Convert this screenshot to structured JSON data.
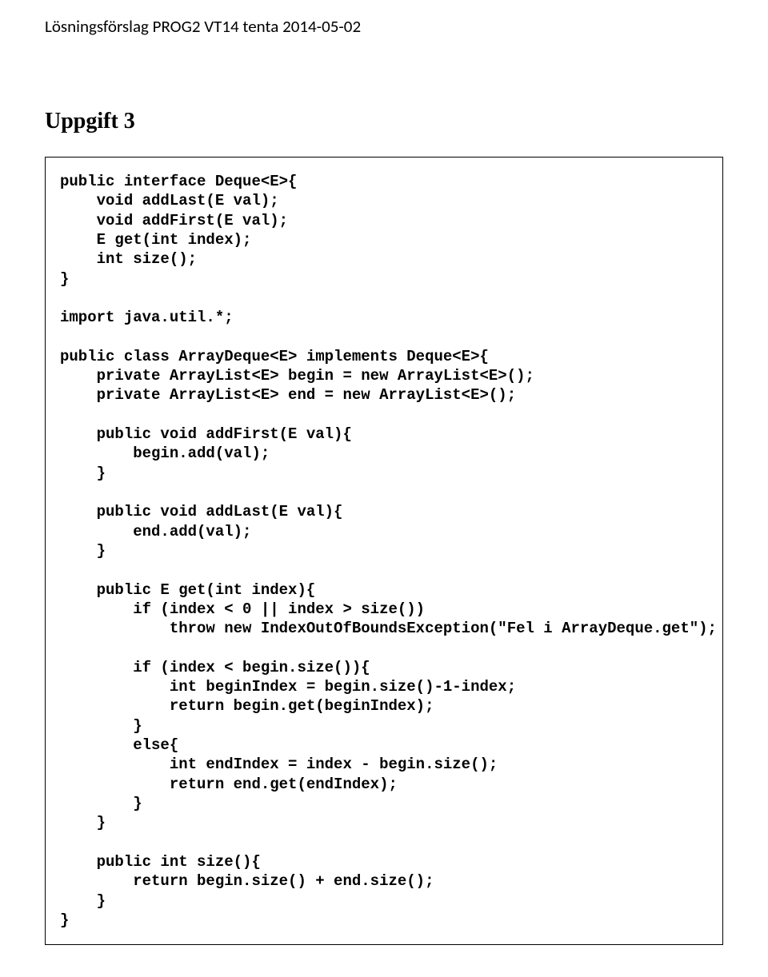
{
  "header": "Lösningsförslag PROG2 VT14 tenta 2014-05-02",
  "task_title": "Uppgift 3",
  "code": "public interface Deque<E>{\n    void addLast(E val);\n    void addFirst(E val);\n    E get(int index);\n    int size();\n}\n\nimport java.util.*;\n\npublic class ArrayDeque<E> implements Deque<E>{\n    private ArrayList<E> begin = new ArrayList<E>();\n    private ArrayList<E> end = new ArrayList<E>();\n\n    public void addFirst(E val){\n        begin.add(val);\n    }\n\n    public void addLast(E val){\n        end.add(val);\n    }\n\n    public E get(int index){\n        if (index < 0 || index > size())\n            throw new IndexOutOfBoundsException(\"Fel i ArrayDeque.get\");\n\n        if (index < begin.size()){\n            int beginIndex = begin.size()-1-index;\n            return begin.get(beginIndex);\n        }\n        else{\n            int endIndex = index - begin.size();\n            return end.get(endIndex);\n        }\n    }\n\n    public int size(){\n        return begin.size() + end.size();\n    }\n}"
}
